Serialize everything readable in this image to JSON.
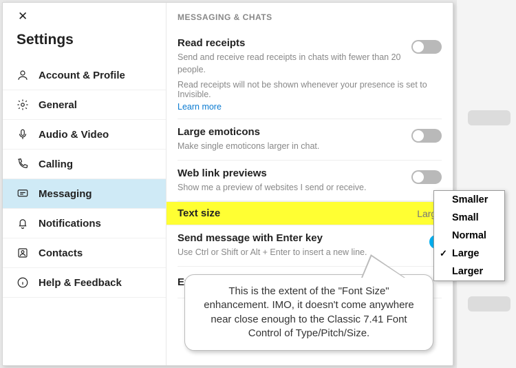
{
  "sidebar": {
    "title": "Settings",
    "items": [
      {
        "label": "Account & Profile"
      },
      {
        "label": "General"
      },
      {
        "label": "Audio & Video"
      },
      {
        "label": "Calling"
      },
      {
        "label": "Messaging"
      },
      {
        "label": "Notifications"
      },
      {
        "label": "Contacts"
      },
      {
        "label": "Help & Feedback"
      }
    ]
  },
  "main": {
    "section_header": "MESSAGING & CHATS",
    "read_receipts": {
      "title": "Read receipts",
      "desc": "Send and receive read receipts in chats with fewer than 20 people.",
      "note": "Read receipts will not be shown whenever your presence is set to Invisible.",
      "link": "Learn more"
    },
    "large_emoticons": {
      "title": "Large emoticons",
      "desc": "Make single emoticons larger in chat."
    },
    "web_link": {
      "title": "Web link previews",
      "desc": "Show me a preview of websites I send or receive."
    },
    "text_size": {
      "title": "Text size",
      "value": "Large"
    },
    "send_enter": {
      "title": "Send message with Enter key",
      "desc": "Use Ctrl or Shift or Alt + Enter to insert a new line."
    },
    "export": {
      "title": "Export chat history from Skype 7.x"
    }
  },
  "popup": {
    "items": [
      "Smaller",
      "Small",
      "Normal",
      "Large",
      "Larger"
    ],
    "selected": "Large"
  },
  "callout": "This is the extent of the \"Font Size\" enhancement.  IMO, it doesn't come anywhere near close enough to the Classic 7.41 Font Control of Type/Pitch/Size."
}
